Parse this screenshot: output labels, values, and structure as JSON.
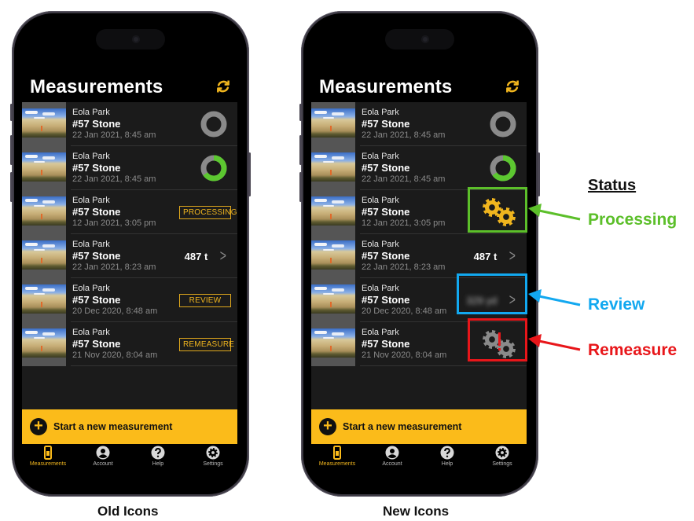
{
  "phones": [
    {
      "caption": "Old Icons",
      "title": "Measurements",
      "refresh_icon": "refresh-icon",
      "rows": [
        {
          "site": "Eola Park",
          "name": "#57 Stone",
          "date": "22 Jan 2021, 8:45 am",
          "status": "queued",
          "progress": 0
        },
        {
          "site": "Eola Park",
          "name": "#57 Stone",
          "date": "22 Jan 2021, 8:45 am",
          "status": "uploading",
          "progress": 0.65
        },
        {
          "site": "Eola Park",
          "name": "#57 Stone",
          "date": "12 Jan 2021, 3:05 pm",
          "status": "processing",
          "badge": "PROCESSING"
        },
        {
          "site": "Eola Park",
          "name": "#57 Stone",
          "date": "22 Jan 2021, 8:23 am",
          "status": "complete",
          "value": "487 t"
        },
        {
          "site": "Eola Park",
          "name": "#57 Stone",
          "date": "20 Dec 2020, 8:48 am",
          "status": "review",
          "badge": "REVIEW"
        },
        {
          "site": "Eola Park",
          "name": "#57 Stone",
          "date": "21 Nov 2020, 8:04 am",
          "status": "remeasure",
          "badge": "REMEASURE"
        }
      ],
      "cta": "Start a new measurement",
      "tabs": [
        {
          "label": "Measurements",
          "icon": "phone-icon",
          "active": true
        },
        {
          "label": "Account",
          "icon": "account-icon",
          "active": false
        },
        {
          "label": "Help",
          "icon": "help-icon",
          "active": false
        },
        {
          "label": "Settings",
          "icon": "settings-icon",
          "active": false
        }
      ]
    },
    {
      "caption": "New Icons",
      "title": "Measurements",
      "refresh_icon": "refresh-icon",
      "rows": [
        {
          "site": "Eola Park",
          "name": "#57 Stone",
          "date": "22 Jan 2021, 8:45 am",
          "status": "queued",
          "progress": 0
        },
        {
          "site": "Eola Park",
          "name": "#57 Stone",
          "date": "22 Jan 2021, 8:45 am",
          "status": "uploading",
          "progress": 0.65
        },
        {
          "site": "Eola Park",
          "name": "#57 Stone",
          "date": "12 Jan 2021, 3:05 pm",
          "status": "processing",
          "icon": "gears-icon"
        },
        {
          "site": "Eola Park",
          "name": "#57 Stone",
          "date": "22 Jan 2021, 8:23 am",
          "status": "complete",
          "value": "487 t"
        },
        {
          "site": "Eola Park",
          "name": "#57 Stone",
          "date": "20 Dec 2020, 8:48 am",
          "status": "review",
          "value": "329 yd",
          "blurred": true
        },
        {
          "site": "Eola Park",
          "name": "#57 Stone",
          "date": "21 Nov 2020, 8:04 am",
          "status": "remeasure",
          "icon": "gears-alert-icon"
        }
      ],
      "cta": "Start a new measurement",
      "tabs": [
        {
          "label": "Measurements",
          "icon": "phone-icon",
          "active": true
        },
        {
          "label": "Account",
          "icon": "account-icon",
          "active": false
        },
        {
          "label": "Help",
          "icon": "help-icon",
          "active": false
        },
        {
          "label": "Settings",
          "icon": "settings-icon",
          "active": false
        }
      ]
    }
  ],
  "legend": {
    "title": "Status",
    "items": [
      {
        "label": "Processing",
        "color": "#5cbf2a"
      },
      {
        "label": "Review",
        "color": "#12a8f0"
      },
      {
        "label": "Remeasure",
        "color": "#e8161a"
      }
    ]
  },
  "colors": {
    "accent": "#fbbb1a",
    "ring_track": "#8a8a8a",
    "ring_fill": "#5cc730",
    "badge": "#e0a81c",
    "gear_active": "#f0b51e",
    "gear_inactive": "#8a8a8a",
    "alert": "#e8161a"
  }
}
